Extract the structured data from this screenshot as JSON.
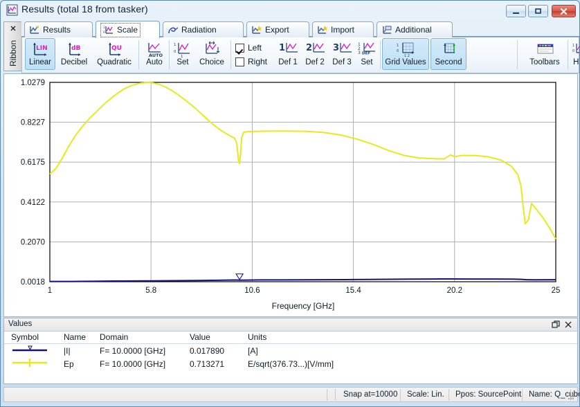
{
  "window": {
    "title": "Results (total 18 from tasker)",
    "icon": "chart-window-icon",
    "buttons": {
      "minimize": "minimize-button",
      "maximize": "maximize-button",
      "close": "close-button"
    }
  },
  "ribbon_dock": {
    "close_glyph": "✕",
    "label": "Ribbon"
  },
  "tabs": [
    {
      "label": "Results",
      "icon": "results-icon",
      "active": false
    },
    {
      "label": "Scale",
      "icon": "scale-icon",
      "active": true
    },
    {
      "label": "Radiation",
      "icon": "radiation-icon",
      "active": false
    },
    {
      "label": "Export",
      "icon": "export-icon",
      "active": false
    },
    {
      "label": "Import",
      "icon": "import-icon",
      "active": false
    },
    {
      "label": "Additional",
      "icon": "additional-icon",
      "active": false
    }
  ],
  "ribbon": {
    "buttons": [
      {
        "label": "Linear",
        "icon": "linear-scale-icon",
        "selected": true,
        "badge": "LIN"
      },
      {
        "label": "Decibel",
        "icon": "decibel-scale-icon",
        "selected": false,
        "badge": "dB"
      },
      {
        "label": "Quadratic",
        "icon": "quadratic-scale-icon",
        "selected": false,
        "badge": "QU"
      },
      {
        "label": "Auto",
        "icon": "auto-range-icon",
        "selected": false,
        "badge": "AUTO"
      },
      {
        "label": "Set",
        "icon": "set-range-icon",
        "selected": false,
        "badge": ""
      },
      {
        "label": "Choice",
        "icon": "choice-range-icon",
        "selected": false,
        "badge": ""
      },
      {
        "label": "Def 1",
        "icon": "def1-icon",
        "selected": false,
        "badge": "1"
      },
      {
        "label": "Def 2",
        "icon": "def2-icon",
        "selected": false,
        "badge": "2"
      },
      {
        "label": "Def 3",
        "icon": "def3-icon",
        "selected": false,
        "badge": "3"
      },
      {
        "label": "Set",
        "icon": "def-set-icon",
        "selected": false,
        "badge": "3DEF"
      },
      {
        "label": "Grid Values",
        "icon": "grid-values-icon",
        "selected": true,
        "badge": ""
      },
      {
        "label": "Second",
        "icon": "second-axis-icon",
        "selected": true,
        "badge": ""
      },
      {
        "label": "Toolbars",
        "icon": "toolbars-icon",
        "selected": false,
        "badge": ""
      },
      {
        "label": "Help",
        "icon": "help-icon",
        "selected": false,
        "badge": "?"
      }
    ],
    "checkboxes": [
      {
        "label": "Left",
        "checked": true
      },
      {
        "label": "Right",
        "checked": false
      }
    ]
  },
  "chart_data": {
    "type": "line",
    "title": "",
    "xlabel": "Frequency [GHz]",
    "ylabel": "",
    "xlim": [
      1,
      25
    ],
    "ylim": [
      0.0018,
      1.0279
    ],
    "xticks": [
      "1",
      "5.8",
      "10.6",
      "15.4",
      "20.2",
      "25"
    ],
    "xtick_values": [
      1,
      5.8,
      10.6,
      15.4,
      20.2,
      25
    ],
    "yticks": [
      "0.0018",
      "0.2070",
      "0.4122",
      "0.6175",
      "0.8227",
      "1.0279"
    ],
    "ytick_values": [
      0.0018,
      0.207,
      0.4122,
      0.6175,
      0.8227,
      1.0279
    ],
    "grid": true,
    "legend": "none",
    "series": [
      {
        "name": "Ep",
        "color": "#e8e81c",
        "x": [
          1.0,
          1.3,
          1.6,
          1.9,
          2.2,
          2.5,
          2.9,
          3.3,
          3.7,
          4.1,
          4.5,
          4.9,
          5.3,
          5.6,
          5.9,
          6.2,
          6.5,
          6.8,
          7.1,
          7.5,
          7.9,
          8.3,
          8.7,
          9.1,
          9.4,
          9.6,
          9.75,
          9.85,
          9.9,
          9.95,
          10.0,
          10.05,
          10.1,
          10.2,
          10.45,
          10.8,
          11.5,
          12.3,
          13.2,
          14.0,
          14.8,
          15.6,
          16.4,
          17.1,
          17.8,
          18.5,
          19.2,
          19.7,
          20.0,
          20.2,
          20.6,
          21.2,
          21.8,
          22.4,
          22.9,
          23.2,
          23.35,
          23.45,
          23.55,
          23.7,
          23.85,
          24.1,
          24.4,
          24.7,
          25.0
        ],
        "y": [
          0.556,
          0.586,
          0.64,
          0.7,
          0.752,
          0.795,
          0.845,
          0.887,
          0.928,
          0.963,
          0.993,
          1.013,
          1.024,
          1.027,
          1.025,
          1.017,
          1.003,
          0.985,
          0.963,
          0.93,
          0.895,
          0.855,
          0.815,
          0.782,
          0.762,
          0.75,
          0.742,
          0.72,
          0.68,
          0.625,
          0.61,
          0.66,
          0.745,
          0.772,
          0.775,
          0.776,
          0.777,
          0.777,
          0.776,
          0.77,
          0.757,
          0.735,
          0.706,
          0.676,
          0.652,
          0.639,
          0.635,
          0.634,
          0.654,
          0.646,
          0.652,
          0.651,
          0.645,
          0.628,
          0.596,
          0.553,
          0.495,
          0.39,
          0.3,
          0.32,
          0.405,
          0.372,
          0.33,
          0.28,
          0.222
        ]
      },
      {
        "name": "|I|",
        "color": "#12127e",
        "x": [
          1.0,
          2.0,
          3.0,
          4.0,
          5.0,
          6.0,
          7.0,
          8.0,
          9.0,
          9.8,
          10.0,
          10.4,
          11.0,
          12.0,
          13.0,
          14.0,
          15.0,
          16.0,
          17.0,
          18.0,
          19.0,
          20.0,
          21.0,
          22.0,
          23.0,
          23.4,
          23.6,
          24.0,
          25.0
        ],
        "y": [
          0.003,
          0.0033,
          0.0042,
          0.0052,
          0.006,
          0.0063,
          0.007,
          0.0082,
          0.0095,
          0.0105,
          0.0098,
          0.0102,
          0.011,
          0.0112,
          0.0115,
          0.0122,
          0.0125,
          0.0132,
          0.0145,
          0.0152,
          0.0158,
          0.016,
          0.0158,
          0.0155,
          0.015,
          0.014,
          0.012,
          0.0118,
          0.012
        ]
      }
    ],
    "marker": {
      "x": 10.0,
      "series": "|I|",
      "glyph": "marker-flag-icon"
    },
    "plot_bg": "#ffffff",
    "grid_color": "#a8a8a8",
    "frame_color": "#000000"
  },
  "values_panel": {
    "title": "Values",
    "undock_icon": "undock-icon",
    "close_icon": "close-icon",
    "columns": [
      "Symbol",
      "Name",
      "Domain",
      "Value",
      "Units"
    ],
    "rows": [
      {
        "symbol_color": "#12127e",
        "symbol_name": "legend-line-current",
        "name": "|I|",
        "domain": "F= 10.0000 [GHz]",
        "value": "0.017890",
        "units": "[A]"
      },
      {
        "symbol_color": "#e8e81c",
        "symbol_name": "legend-line-efield",
        "name": "Ep",
        "domain": "F= 10.0000 [GHz]",
        "value": "0.713271",
        "units": "E/sqrt(376.73...)[V/mm]"
      }
    ]
  },
  "statusbar": {
    "cells": [
      {
        "text": "Snap at=10000"
      },
      {
        "text": "Scale: Lin."
      },
      {
        "text": "Ppos: SourcePoint"
      },
      {
        "text": "Name: Q_cuboid_S"
      }
    ],
    "grip": "resize-grip"
  }
}
